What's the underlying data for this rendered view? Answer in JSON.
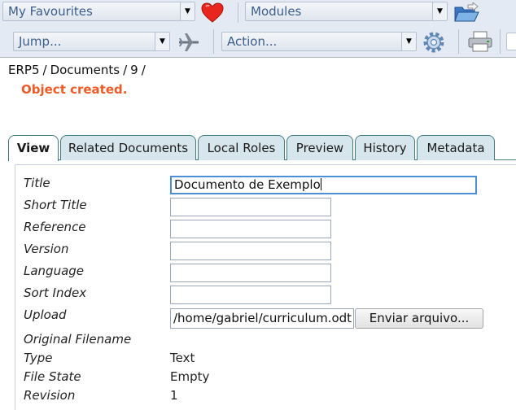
{
  "toolbar": {
    "favourites": "My Favourites",
    "modules": "Modules",
    "jump": "Jump...",
    "action": "Action..."
  },
  "breadcrumb": [
    "ERP5",
    "/",
    "Documents",
    "/",
    "9",
    "/"
  ],
  "message": "Object created.",
  "tabs": [
    "View",
    "Related Documents",
    "Local Roles",
    "Preview",
    "History",
    "Metadata"
  ],
  "form": {
    "title_label": "Title",
    "title_value": "Documento de Exemplo",
    "short_title_label": "Short Title",
    "reference_label": "Reference",
    "version_label": "Version",
    "language_label": "Language",
    "sort_index_label": "Sort Index",
    "upload_label": "Upload",
    "upload_value": "/home/gabriel/curriculum.odt",
    "upload_button": "Enviar arquivo...",
    "original_filename_label": "Original Filename",
    "type_label": "Type",
    "type_value": "Text",
    "file_state_label": "File State",
    "file_state_value": "Empty",
    "revision_label": "Revision",
    "revision_value": "1"
  },
  "colors": {
    "toolbar_bg": "#e3eaf4",
    "message": "#f15a24",
    "tab_border": "#3f7c7d",
    "tab_bg": "#d7e6ec"
  },
  "icons": [
    "heart-icon",
    "folder-open-icon",
    "airplane-icon",
    "gear-icon",
    "printer-icon"
  ]
}
